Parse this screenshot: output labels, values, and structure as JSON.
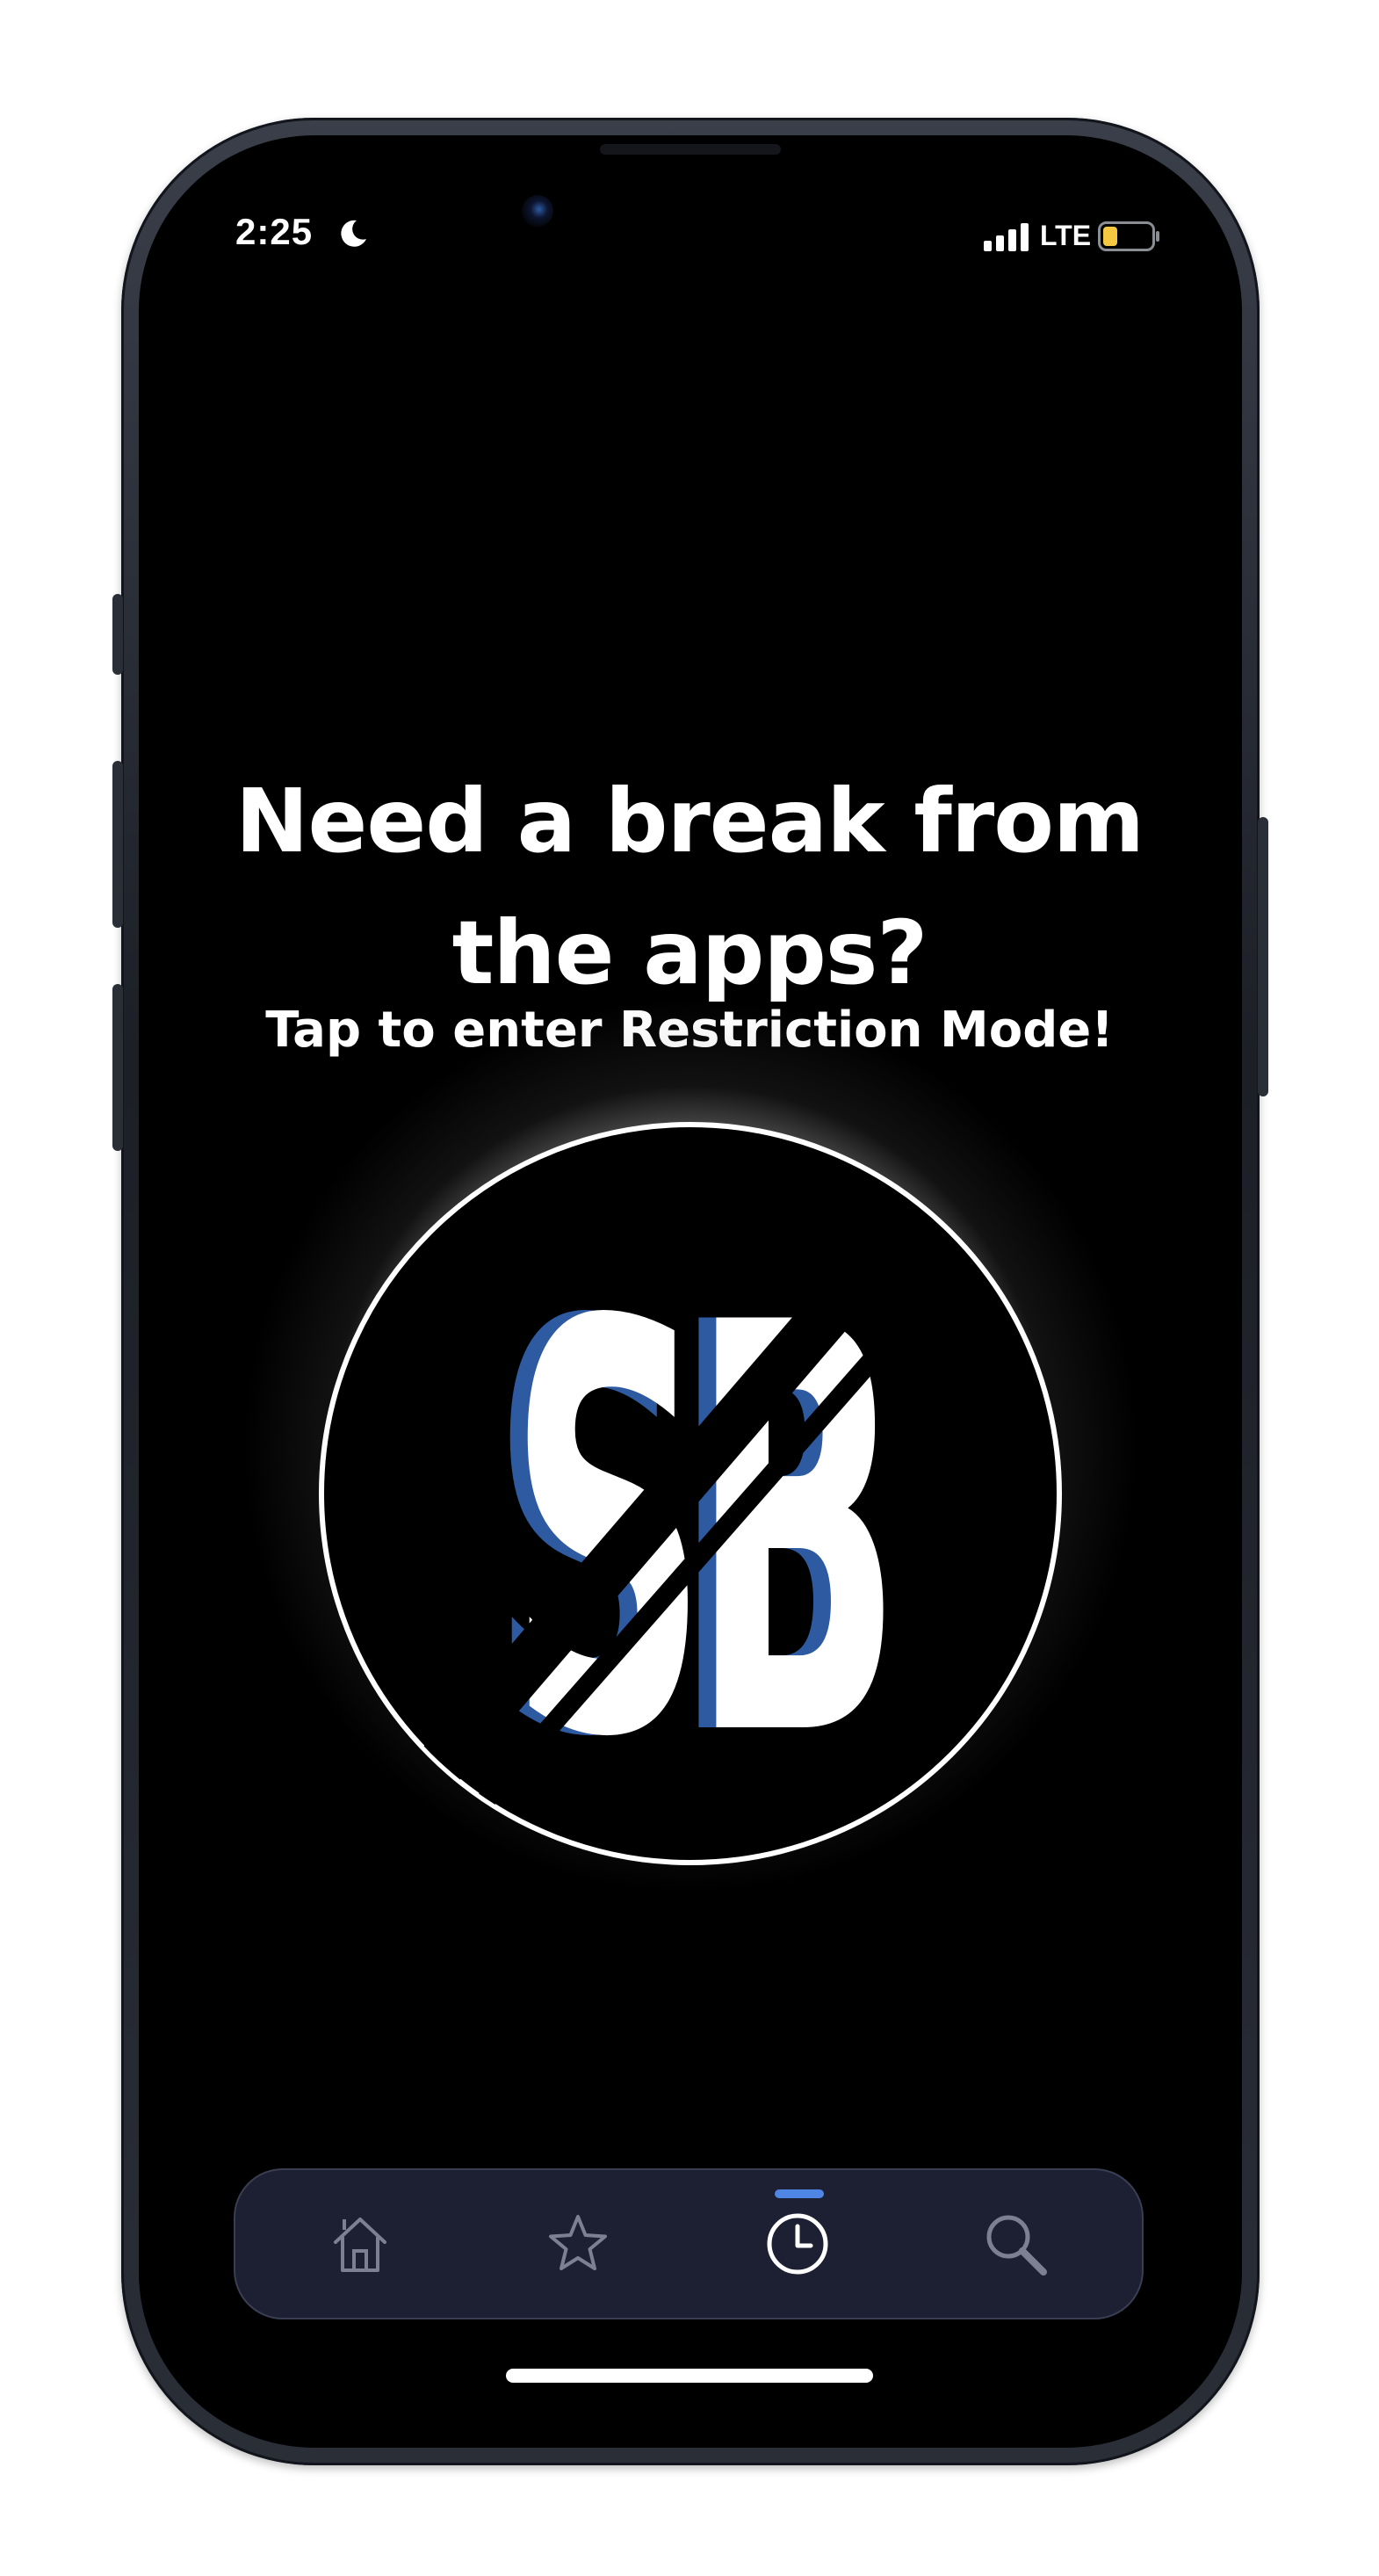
{
  "status_bar": {
    "time": "2:25",
    "network": "LTE",
    "icons": [
      "moon-icon",
      "signal-bars-icon",
      "battery-icon"
    ]
  },
  "main": {
    "headline": "Need a break from the apps?",
    "subheadline": "Tap to enter Restriction Mode!",
    "logo": {
      "text": "SB",
      "accent_color": "#2d5aa0",
      "icon": "sb-restriction-logo"
    }
  },
  "tab_bar": {
    "active_index": 2,
    "accent_color": "#4f86e6",
    "tabs": [
      {
        "icon": "home-icon"
      },
      {
        "icon": "star-icon"
      },
      {
        "icon": "clock-icon"
      },
      {
        "icon": "search-icon"
      }
    ]
  }
}
